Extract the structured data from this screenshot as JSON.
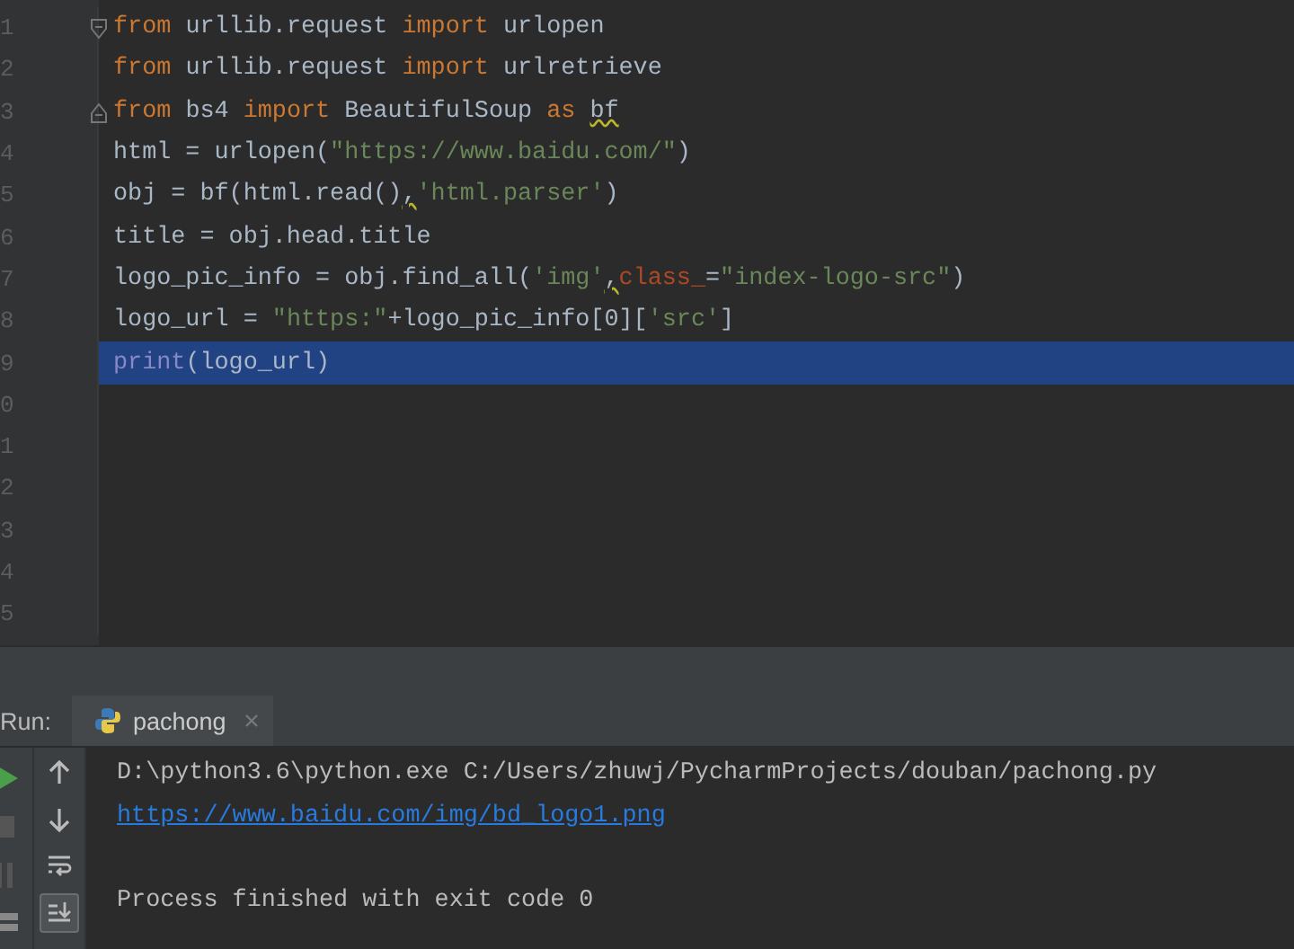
{
  "editor": {
    "lines": [
      {
        "number": "1",
        "selected": false,
        "fold_open": true,
        "tokens": [
          {
            "kind": "keyword",
            "text": "from"
          },
          {
            "kind": "plain",
            "text": " urllib.request "
          },
          {
            "kind": "keyword",
            "text": "import"
          },
          {
            "kind": "plain",
            "text": " urlopen"
          }
        ]
      },
      {
        "number": "2",
        "selected": false,
        "tokens": [
          {
            "kind": "keyword",
            "text": "from"
          },
          {
            "kind": "plain",
            "text": " urllib.request "
          },
          {
            "kind": "keyword",
            "text": "import"
          },
          {
            "kind": "plain",
            "text": " urlretrieve"
          }
        ]
      },
      {
        "number": "3",
        "selected": false,
        "fold_close": true,
        "tokens": [
          {
            "kind": "keyword",
            "text": "from"
          },
          {
            "kind": "plain",
            "text": " bs4 "
          },
          {
            "kind": "keyword",
            "text": "import"
          },
          {
            "kind": "plain",
            "text": " BeautifulSoup "
          },
          {
            "kind": "keyword",
            "text": "as "
          },
          {
            "kind": "warn",
            "text": "bf"
          }
        ]
      },
      {
        "number": "4",
        "selected": false,
        "tokens": [
          {
            "kind": "plain",
            "text": "html = urlopen("
          },
          {
            "kind": "string",
            "text": "\"https://www.baidu.com/\""
          },
          {
            "kind": "plain",
            "text": ")"
          }
        ]
      },
      {
        "number": "5",
        "selected": false,
        "tokens": [
          {
            "kind": "plain",
            "text": "obj = bf(html.read()"
          },
          {
            "kind": "warn",
            "text": ","
          },
          {
            "kind": "string",
            "text": "'html.parser'"
          },
          {
            "kind": "plain",
            "text": ")"
          }
        ]
      },
      {
        "number": "6",
        "selected": false,
        "tokens": [
          {
            "kind": "plain",
            "text": "title = obj.head.title"
          }
        ]
      },
      {
        "number": "7",
        "selected": false,
        "tokens": [
          {
            "kind": "plain",
            "text": "logo_pic_info = obj.find_all("
          },
          {
            "kind": "string",
            "text": "'img'"
          },
          {
            "kind": "warn",
            "text": ","
          },
          {
            "kind": "param",
            "text": "class_"
          },
          {
            "kind": "plain",
            "text": "="
          },
          {
            "kind": "string",
            "text": "\"index-logo-src\""
          },
          {
            "kind": "plain",
            "text": ")"
          }
        ]
      },
      {
        "number": "8",
        "selected": false,
        "tokens": [
          {
            "kind": "plain",
            "text": "logo_url = "
          },
          {
            "kind": "string",
            "text": "\"https:\""
          },
          {
            "kind": "plain",
            "text": "+logo_pic_info[0]["
          },
          {
            "kind": "string",
            "text": "'src'"
          },
          {
            "kind": "plain",
            "text": "]"
          }
        ]
      },
      {
        "number": "9",
        "selected": true,
        "tokens": [
          {
            "kind": "builtin",
            "text": "print"
          },
          {
            "kind": "plain",
            "text": "(logo_url)"
          }
        ]
      },
      {
        "number": "0",
        "selected": false
      },
      {
        "number": "1",
        "selected": false
      },
      {
        "number": "2",
        "selected": false
      },
      {
        "number": "3",
        "selected": false
      },
      {
        "number": "4",
        "selected": false
      },
      {
        "number": "5",
        "selected": false
      }
    ]
  },
  "run": {
    "label": "Run:",
    "tab": {
      "title": "pachong",
      "closable": true
    },
    "tools": [
      {
        "kind": "up",
        "selected": false
      },
      {
        "kind": "down",
        "selected": false
      },
      {
        "kind": "wrap",
        "selected": false
      },
      {
        "kind": "scroll-end",
        "selected": true
      }
    ],
    "output": [
      {
        "kind": "plain",
        "text": "D:\\python3.6\\python.exe C:/Users/zhuwj/PycharmProjects/douban/pachong.py"
      },
      {
        "kind": "link",
        "text": "https://www.baidu.com/img/bd_logo1.png"
      },
      {
        "kind": "blank"
      },
      {
        "kind": "plain",
        "text": "Process finished with exit code 0"
      }
    ]
  }
}
